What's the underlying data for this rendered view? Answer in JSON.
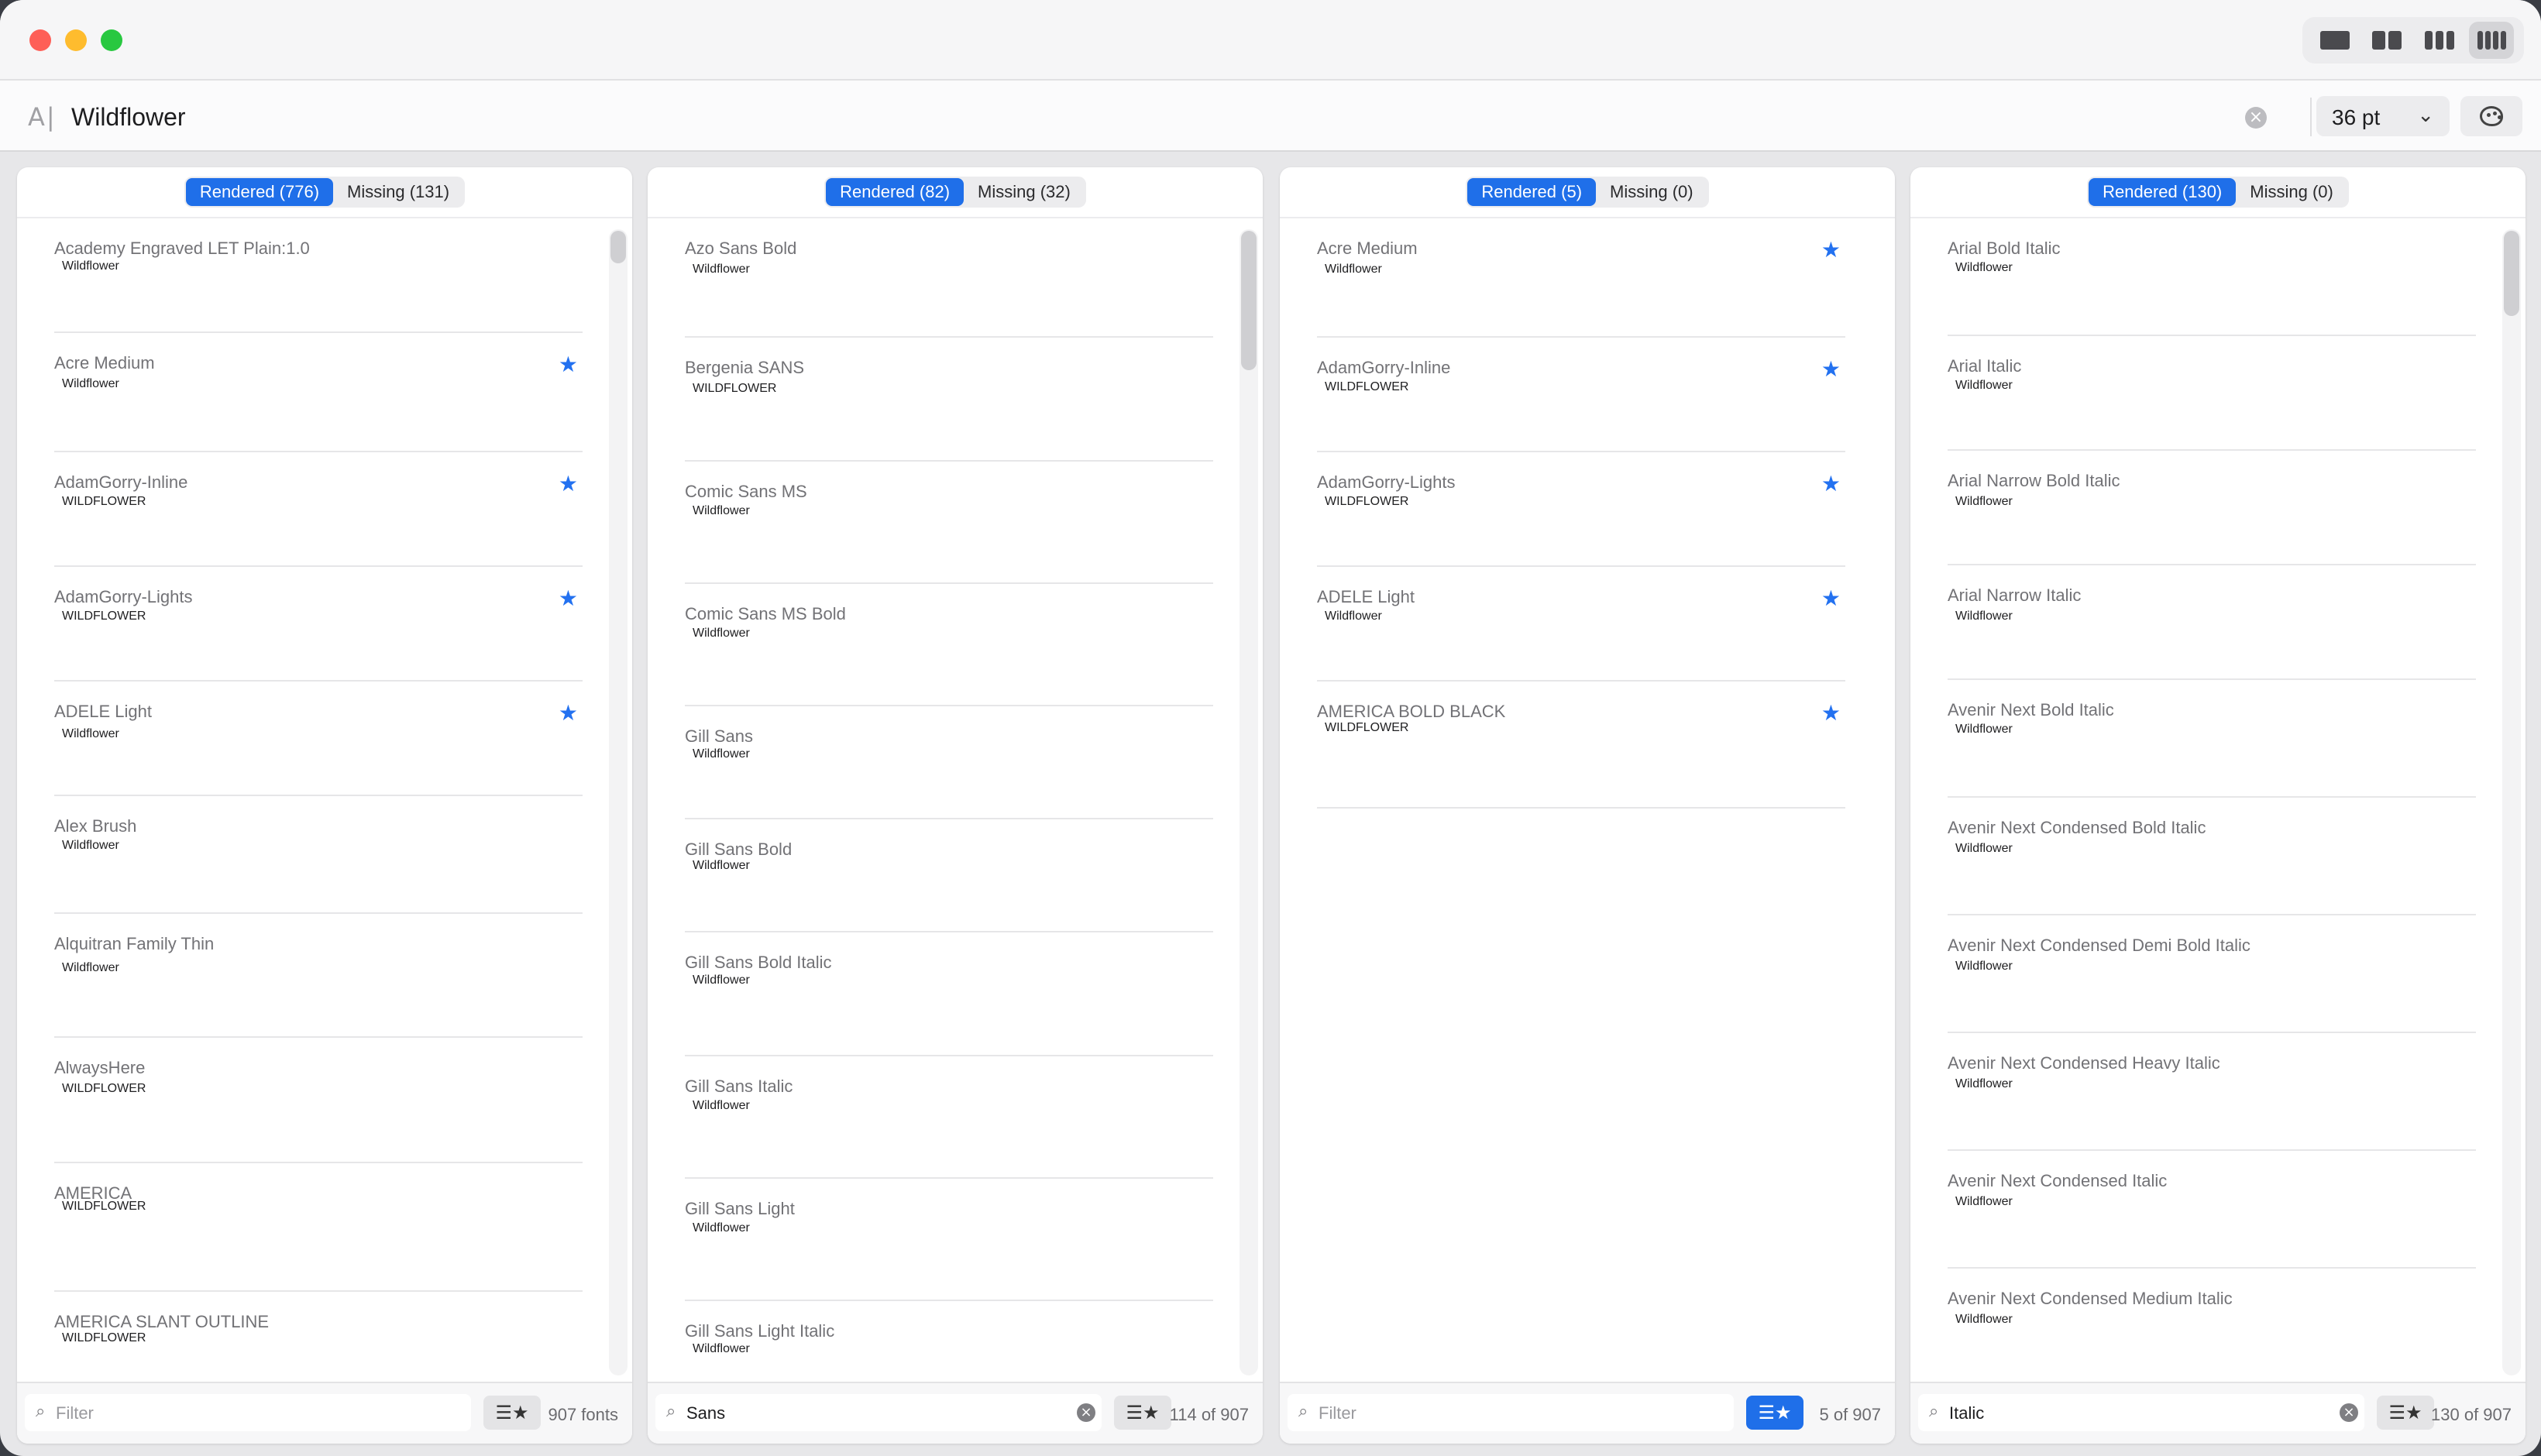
{
  "toolbar": {
    "layout_buttons": [
      {
        "icon": "single-column-icon",
        "selected": false
      },
      {
        "icon": "two-columns-icon",
        "selected": false
      },
      {
        "icon": "three-columns-icon",
        "selected": false
      },
      {
        "icon": "four-columns-icon",
        "selected": true
      }
    ]
  },
  "search": {
    "icon": "A|",
    "text": "Wildflower",
    "size": "36 pt"
  },
  "columns": [
    {
      "rendered_label": "Rendered (776)",
      "missing_label": "Missing (131)",
      "filter": "",
      "filter_placeholder": "Filter",
      "count": "907 fonts",
      "favorites_on": false,
      "fonts": [
        {
          "name": "Academy Engraved LET Plain:1.0",
          "sample": "Wildflower",
          "star": false
        },
        {
          "name": "Acre Medium",
          "sample": "Wildflower",
          "star": true
        },
        {
          "name": "AdamGorry-Inline",
          "sample": "WILDFLOWER",
          "star": true
        },
        {
          "name": "AdamGorry-Lights",
          "sample": "WILDFLOWER",
          "star": true
        },
        {
          "name": "ADELE Light",
          "sample": "Wildflower",
          "star": true
        },
        {
          "name": "Alex Brush",
          "sample": "Wildflower",
          "star": false
        },
        {
          "name": "Alquitran Family Thin",
          "sample": "Wildflower",
          "star": false
        },
        {
          "name": "AlwaysHere",
          "sample": "WILDFLOWER",
          "star": false
        },
        {
          "name": "AMERICA",
          "sample": "WILDFLOWER",
          "star": false
        },
        {
          "name": "AMERICA  SLANT OUTLINE",
          "sample": "WILDFLOWER",
          "star": false
        }
      ]
    },
    {
      "rendered_label": "Rendered (82)",
      "missing_label": "Missing (32)",
      "filter": "Sans",
      "filter_placeholder": "Filter",
      "count": "114 of 907",
      "favorites_on": false,
      "fonts": [
        {
          "name": "Azo Sans Bold",
          "sample": "Wildflower",
          "star": false
        },
        {
          "name": "Bergenia SANS",
          "sample": "WILDFLOWER",
          "star": false
        },
        {
          "name": "Comic Sans MS",
          "sample": "Wildflower",
          "star": false
        },
        {
          "name": "Comic Sans MS Bold",
          "sample": "Wildflower",
          "star": false
        },
        {
          "name": "Gill Sans",
          "sample": "Wildflower",
          "star": false
        },
        {
          "name": "Gill Sans Bold",
          "sample": "Wildflower",
          "star": false
        },
        {
          "name": "Gill Sans Bold Italic",
          "sample": "Wildflower",
          "star": false
        },
        {
          "name": "Gill Sans Italic",
          "sample": "Wildflower",
          "star": false
        },
        {
          "name": "Gill Sans Light",
          "sample": "Wildflower",
          "star": false
        },
        {
          "name": "Gill Sans Light Italic",
          "sample": "Wildflower",
          "star": false
        }
      ]
    },
    {
      "rendered_label": "Rendered (5)",
      "missing_label": "Missing (0)",
      "filter": "",
      "filter_placeholder": "Filter",
      "count": "5 of 907",
      "favorites_on": true,
      "fonts": [
        {
          "name": "Acre Medium",
          "sample": "Wildflower",
          "star": true
        },
        {
          "name": "AdamGorry-Inline",
          "sample": "WILDFLOWER",
          "star": true
        },
        {
          "name": "AdamGorry-Lights",
          "sample": "WILDFLOWER",
          "star": true
        },
        {
          "name": "ADELE Light",
          "sample": "Wildflower",
          "star": true
        },
        {
          "name": "AMERICA BOLD BLACK",
          "sample": "WILDFLOWER",
          "star": true
        }
      ]
    },
    {
      "rendered_label": "Rendered (130)",
      "missing_label": "Missing (0)",
      "filter": "Italic",
      "filter_placeholder": "Filter",
      "count": "130 of 907",
      "favorites_on": false,
      "fonts": [
        {
          "name": "Arial Bold Italic",
          "sample": "Wildflower",
          "star": false
        },
        {
          "name": "Arial Italic",
          "sample": "Wildflower",
          "star": false
        },
        {
          "name": "Arial Narrow Bold Italic",
          "sample": "Wildflower",
          "star": false
        },
        {
          "name": "Arial Narrow Italic",
          "sample": "Wildflower",
          "star": false
        },
        {
          "name": "Avenir Next Bold Italic",
          "sample": "Wildflower",
          "star": false
        },
        {
          "name": "Avenir Next Condensed Bold Italic",
          "sample": "Wildflower",
          "star": false
        },
        {
          "name": "Avenir Next Condensed Demi Bold Italic",
          "sample": "Wildflower",
          "star": false
        },
        {
          "name": "Avenir Next Condensed Heavy Italic",
          "sample": "Wildflower",
          "star": false
        },
        {
          "name": "Avenir Next Condensed Italic",
          "sample": "Wildflower",
          "star": false
        },
        {
          "name": "Avenir Next Condensed Medium Italic",
          "sample": "Wildflower",
          "star": false
        }
      ]
    }
  ],
  "colors": {
    "accent": "#1f6fe9",
    "star": "#2371f0"
  }
}
